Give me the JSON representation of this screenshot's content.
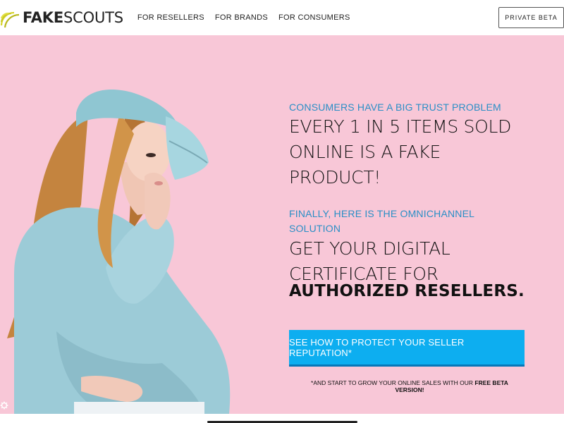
{
  "header": {
    "logo_bold": "FAKE",
    "logo_light": "SCOUTS",
    "nav": [
      {
        "label": "FOR RESELLERS"
      },
      {
        "label": "FOR BRANDS"
      },
      {
        "label": "FOR CONSUMERS"
      }
    ],
    "beta_button": "PRIVATE BETA"
  },
  "hero": {
    "eyebrow1": "CONSUMERS HAVE A BIG TRUST PROBLEM",
    "headline1": "EVERY 1 IN 5 ITEMS SOLD ONLINE IS A FAKE PRODUCT!",
    "eyebrow2": "FINALLY, HERE IS THE OMNICHANNEL SOLUTION",
    "headline2": "GET YOUR DIGITAL CERTIFICATE FOR",
    "headline3": "AUTHORIZED RESELLERS.",
    "cta": "SEE HOW TO PROTECT YOUR SELLER REPUTATION*",
    "footnote_prefix": "*AND START TO GROW YOUR ONLINE SALES WITH OUR ",
    "footnote_bold": "FREE BETA VERSION!"
  },
  "colors": {
    "hero_bg": "#f8c7d7",
    "accent_blue": "#2a8fc6",
    "cta_bg": "#0daef0"
  },
  "icons": {
    "logo": "radar-arcs-icon",
    "gear": "gear-icon"
  }
}
